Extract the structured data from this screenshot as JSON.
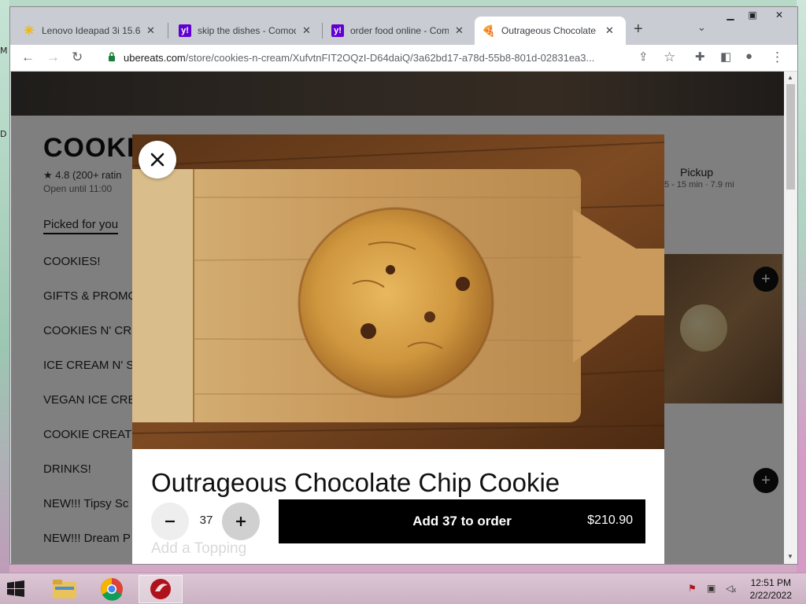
{
  "desktop": {
    "left_glyphs": [
      "M",
      "D"
    ]
  },
  "browser": {
    "tabs": [
      {
        "title": "Lenovo Ideapad 3i 15.6",
        "favicon": "walmart-spark",
        "active": false
      },
      {
        "title": "skip the dishes - Comod",
        "favicon": "yahoo",
        "active": false
      },
      {
        "title": "order food online - Com",
        "favicon": "yahoo",
        "active": false
      },
      {
        "title": "Outrageous Chocolate C",
        "favicon": "pizza",
        "active": true
      }
    ],
    "url_host": "ubereats.com",
    "url_path": "/store/cookies-n-cream/XufvtnFIT2OQzI-D64daiQ/3a62bd17-a78d-55b8-801d-02831ea3...",
    "window_controls": [
      "minimize",
      "maximize",
      "close"
    ]
  },
  "store": {
    "title": "COOKI",
    "rating": "★ 4.8 (200+ ratin",
    "hours": "Open until 11:00",
    "menu": [
      "Picked for you",
      "COOKIES!",
      "GIFTS & PROMO",
      "COOKIES N' CR",
      "ICE CREAM N' S",
      "VEGAN ICE CRE",
      "COOKIE CREAT",
      "DRINKS!",
      "NEW!!! Tipsy Sc",
      "NEW!!! Dream P"
    ],
    "pickup_label": "Pickup",
    "pickup_sub": "5 - 15 min · 7.9 mi"
  },
  "modal": {
    "item_title": "Outrageous Chocolate Chip Cookie",
    "quantity": "37",
    "add_label": "Add 37 to order",
    "price": "$210.90",
    "topping_label": "Add a Topping"
  },
  "taskbar": {
    "time": "12:51 PM",
    "date": "2/22/2022",
    "apps": [
      "file-explorer",
      "chrome",
      "app-red"
    ]
  },
  "colors": {
    "accent": "#000000",
    "uber_black": "#000000",
    "taskbar": "#cbb2c3"
  }
}
